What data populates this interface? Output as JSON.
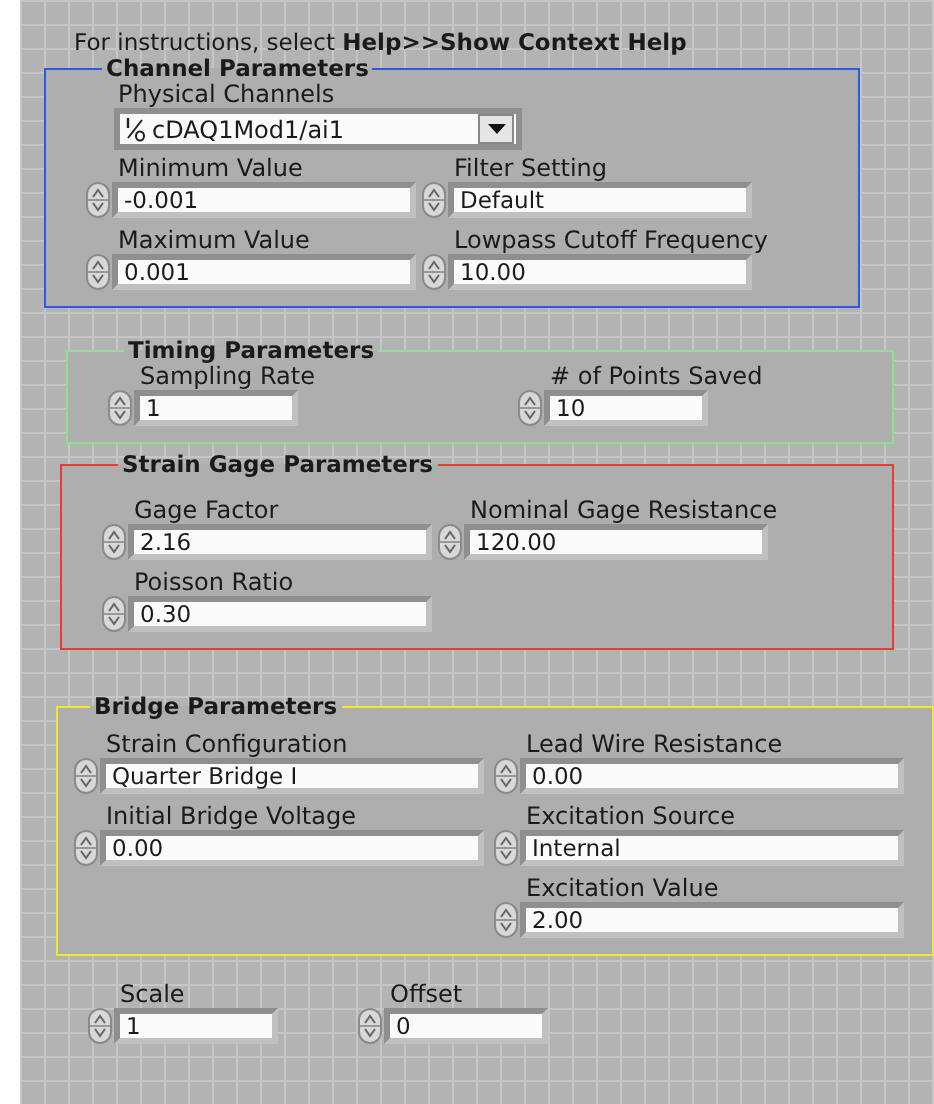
{
  "help_text": "For instructions, select **Help>>Show Context Help**",
  "groups": [
    {
      "title": "Channel Parameters",
      "color": "#2a5ce8",
      "dropdown": {
        "label": "Physical Channels",
        "value": "cDAQ1Mod1/ai1"
      },
      "columns": [
        [
          {
            "label": "Minimum Value",
            "value": "-0.001"
          },
          {
            "label": "Maximum Value",
            "value": "0.001"
          }
        ],
        [
          {
            "label": "Filter Setting",
            "value": "Default"
          },
          {
            "label": "Lowpass Cutoff Frequency",
            "value": "10.00"
          }
        ]
      ]
    },
    {
      "title": "Timing Parameters",
      "color": "#8fe08f",
      "columns": [
        [
          {
            "label": "Sampling Rate",
            "value": "1"
          }
        ],
        [
          {
            "label": "# of Points Saved",
            "value": "10"
          }
        ]
      ]
    },
    {
      "title": "Strain Gage Parameters",
      "color": "#e83a3a",
      "columns": [
        [
          {
            "label": "Gage Factor",
            "value": "2.16"
          },
          {
            "label": "Poisson Ratio",
            "value": "0.30"
          }
        ],
        [
          {
            "label": "Nominal Gage Resistance",
            "value": "120.00"
          }
        ]
      ]
    },
    {
      "title": "Bridge Parameters",
      "color": "#f0e830",
      "columns": [
        [
          {
            "label": "Strain Configuration",
            "value": "Quarter Bridge I"
          },
          {
            "label": "Initial Bridge Voltage",
            "value": "0.00"
          }
        ],
        [
          {
            "label": "Lead Wire Resistance",
            "value": "0.00"
          },
          {
            "label": "Excitation Source",
            "value": "Internal"
          },
          {
            "label": "Excitation Value",
            "value": "2.00"
          }
        ]
      ]
    }
  ],
  "bottom_controls": [
    {
      "label": "Scale",
      "value": "1"
    },
    {
      "label": "Offset",
      "value": "0"
    }
  ]
}
